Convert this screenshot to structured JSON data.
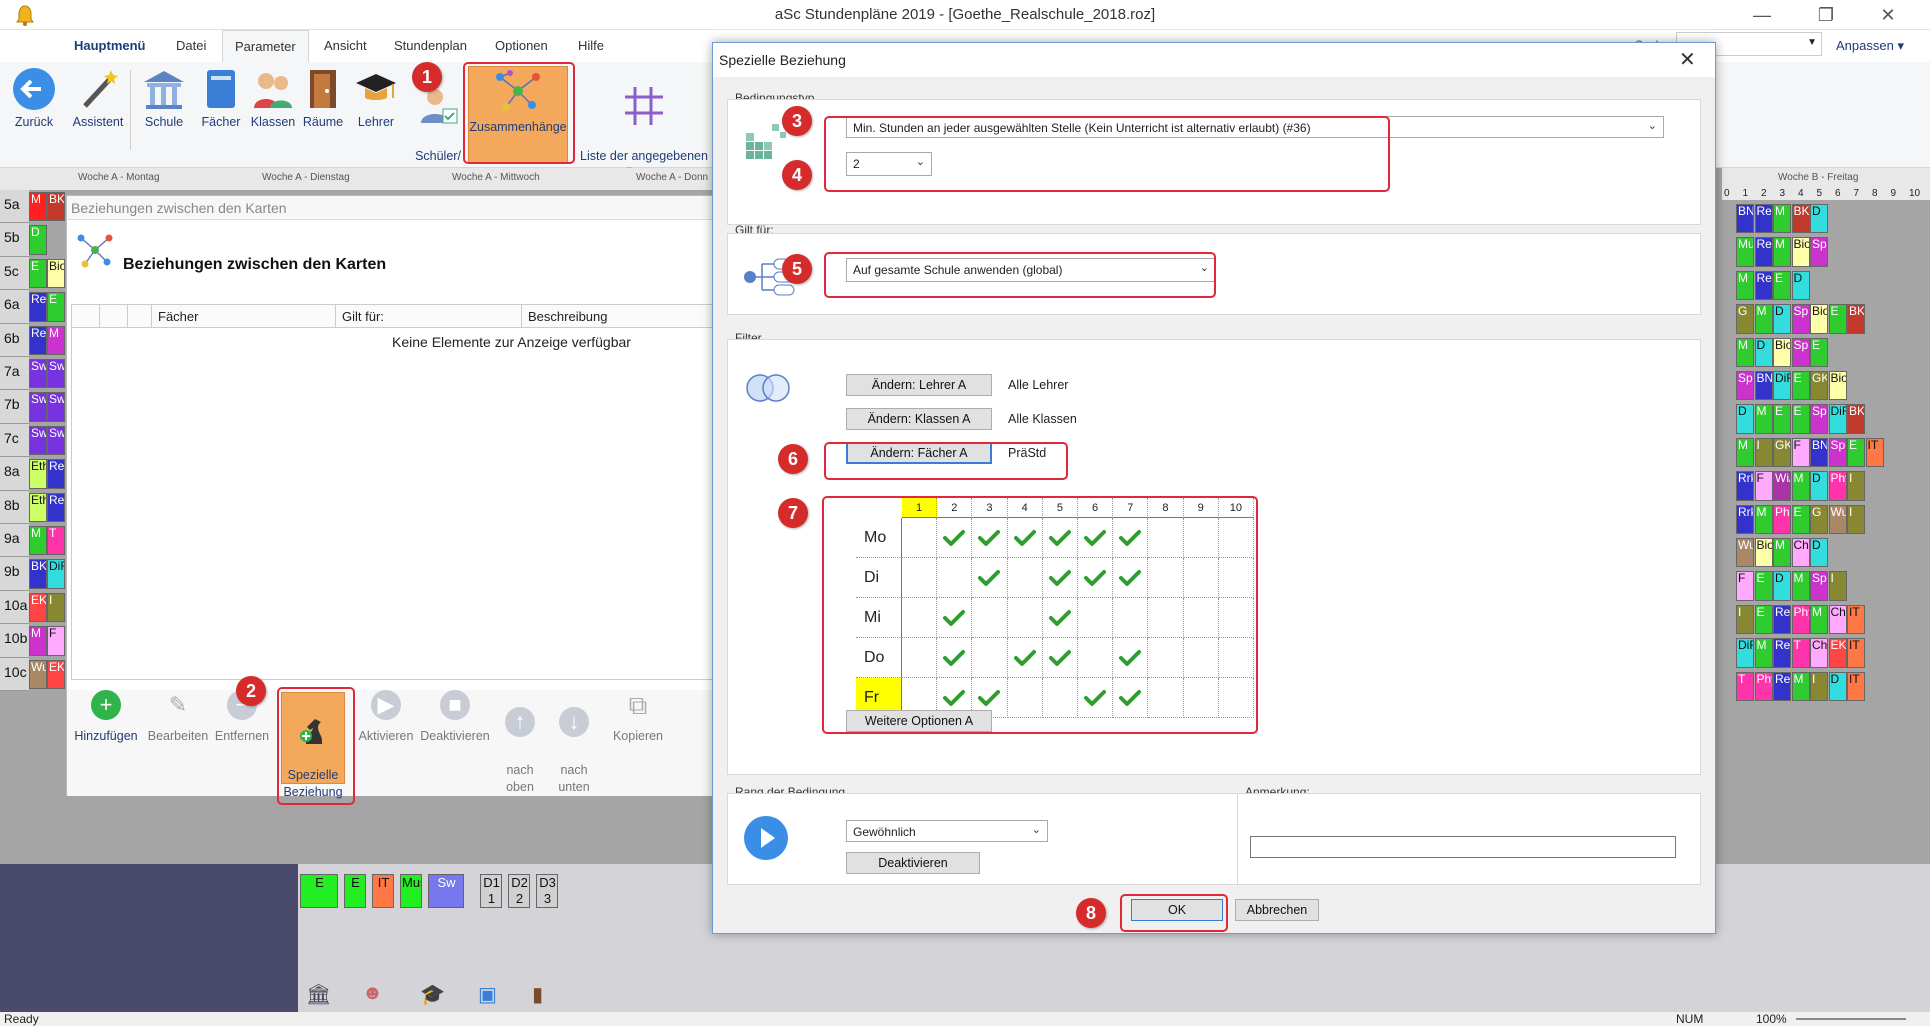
{
  "app": {
    "title": "aSc Stundenpläne 2019  - [Goethe_Realschule_2018.roz]",
    "anpassen": "Anpassen",
    "search_label": "Such"
  },
  "menu_tabs": [
    "Hauptmenü",
    "Datei",
    "Parameter",
    "Ansicht",
    "Stundenplan",
    "Optionen",
    "Hilfe"
  ],
  "ribbon": {
    "buttons": [
      "Zurück",
      "Assistent",
      "Schule",
      "Fächer",
      "Klassen",
      "Räume",
      "Lehrer",
      "Schüler/\nKurse",
      "Zusammenhänge",
      "Liste der angegebenen\nBedingungen"
    ]
  },
  "timetable": {
    "day_headers_left": [
      "Woche A - Montag",
      "Woche A - Dienstag",
      "Woche A - Mittwoch",
      "Woche A - Donn"
    ],
    "day_header_right": "Woche B - Freitag",
    "period_numbers": [
      "0",
      "1",
      "2",
      "3",
      "4",
      "5",
      "6",
      "7",
      "8",
      "9",
      "10"
    ],
    "classes": [
      "5a",
      "5b",
      "5c",
      "6a",
      "6b",
      "7a",
      "7b",
      "7c",
      "8a",
      "8b",
      "9a",
      "9b",
      "10a",
      "10b",
      "10c"
    ],
    "left_cells": [
      [
        {
          "t": "M",
          "c": "#ff2020"
        },
        {
          "t": "BK",
          "c": "#c0392b"
        }
      ],
      [
        {
          "t": "D",
          "c": "#2ecc2e"
        }
      ],
      [
        {
          "t": "E",
          "c": "#2ecc2e"
        },
        {
          "t": "Bio",
          "c": "#ffffaa"
        }
      ],
      [
        {
          "t": "Rev",
          "c": "#3333cc"
        },
        {
          "t": "E",
          "c": "#2ecc2e"
        }
      ],
      [
        {
          "t": "Rev",
          "c": "#3333cc"
        },
        {
          "t": "M",
          "c": "#cc33cc"
        }
      ],
      [
        {
          "t": "Sw",
          "c": "#7733dd"
        },
        {
          "t": "Sw",
          "c": "#7733dd"
        }
      ],
      [
        {
          "t": "Sw",
          "c": "#7733dd"
        },
        {
          "t": "Sw",
          "c": "#7733dd"
        }
      ],
      [
        {
          "t": "Sw",
          "c": "#7733dd"
        },
        {
          "t": "Sw",
          "c": "#7733dd"
        }
      ],
      [
        {
          "t": "Eth",
          "c": "#ccff66"
        },
        {
          "t": "Rev",
          "c": "#3333cc"
        }
      ],
      [
        {
          "t": "Eth",
          "c": "#ccff66"
        },
        {
          "t": "Rev",
          "c": "#3333cc"
        }
      ],
      [
        {
          "t": "M",
          "c": "#2ecc2e"
        },
        {
          "t": "T",
          "c": "#ff33aa"
        }
      ],
      [
        {
          "t": "BK",
          "c": "#3333cc"
        },
        {
          "t": "DiFö",
          "c": "#33dddd"
        }
      ],
      [
        {
          "t": "EK",
          "c": "#ff4444"
        },
        {
          "t": "I",
          "c": "#888833"
        }
      ],
      [
        {
          "t": "M",
          "c": "#cc33cc"
        },
        {
          "t": "F",
          "c": "#ffaaff"
        }
      ],
      [
        {
          "t": "Wu",
          "c": "#aa8866"
        },
        {
          "t": "EK",
          "c": "#ff4444"
        }
      ]
    ],
    "right_rows": [
      [
        "BN",
        "Rev",
        "M",
        "BK",
        "D"
      ],
      [
        "Mus",
        "Rev",
        "M",
        "Bio",
        "Sp"
      ],
      [
        "M",
        "Rev",
        "E",
        "D"
      ],
      [
        "G",
        "M",
        "D",
        "Sp",
        "Bio",
        "E",
        "BK"
      ],
      [
        "M",
        "D",
        "Bio",
        "Sp",
        "E"
      ],
      [
        "Sp",
        "BN",
        "DiFö",
        "E",
        "GK",
        "Bio"
      ],
      [
        "D",
        "M",
        "E",
        "E",
        "Sp",
        "DiFö",
        "BK"
      ],
      [
        "M",
        "I",
        "GK",
        "F",
        "BN",
        "Sp",
        "E",
        "IT"
      ],
      [
        "Rrk",
        "F",
        "Wi/B",
        "M",
        "D",
        "Phy",
        "I"
      ],
      [
        "Rrk",
        "M",
        "Ph",
        "E",
        "G",
        "WuS",
        "I"
      ],
      [
        "WuS",
        "Bio",
        "M",
        "Che",
        "D"
      ],
      [
        "F",
        "E",
        "D",
        "M",
        "Sp",
        "I"
      ],
      [
        "I",
        "E",
        "Rev",
        "Phy",
        "M",
        "Che",
        "IT"
      ],
      [
        "DiFö",
        "M",
        "Rev",
        "T",
        "Che",
        "EK",
        "IT"
      ],
      [
        "T",
        "Phy",
        "Rev",
        "M",
        "I",
        "D",
        "IT"
      ]
    ],
    "right_colors": {
      "BN": "#3333cc",
      "Rev": "#3333cc",
      "M": "#2ecc2e",
      "BK": "#c0392b",
      "D": "#33dddd",
      "Mus": "#2ecc2e",
      "Bio": "#ffffaa",
      "Sp": "#cc33cc",
      "E": "#2ecc2e",
      "G": "#888833",
      "GK": "#888833",
      "DiFö": "#33dddd",
      "F": "#ffaaff",
      "IT": "#ff7744",
      "Rrk": "#3333cc",
      "Wi/B": "#aa33aa",
      "Phy": "#ff33aa",
      "Ph": "#ff33aa",
      "WuS": "#aa8866",
      "Che": "#ffaaff",
      "I": "#888833",
      "T": "#ff33aa",
      "EK": "#ff4444"
    }
  },
  "panel": {
    "header": "Beziehungen zwischen den Karten",
    "title": "Beziehungen zwischen den Karten",
    "columns": [
      "",
      "",
      "",
      "Fächer",
      "Gilt für:",
      "Beschreibung"
    ],
    "empty_text": "Keine Elemente zur Anzeige verfügbar",
    "toolbar": [
      "Hinzufügen",
      "Bearbeiten",
      "Entfernen",
      "Spezielle\nBeziehung",
      "Aktivieren",
      "Deaktivieren",
      "nach\noben",
      "nach\nunten",
      "Kopieren"
    ]
  },
  "bottom_cards": [
    {
      "t": "E",
      "c": "#22ee22"
    },
    {
      "t": "E",
      "c": "#22ee22"
    },
    {
      "t": "IT",
      "c": "#ff7744"
    },
    {
      "t": "Mus",
      "c": "#22ee22"
    },
    {
      "t": "Sw",
      "c": "#7777ee"
    },
    {
      "t": "D1\n1",
      "c": "#d0d0d0"
    },
    {
      "t": "D2\n2",
      "c": "#d0d0d0"
    },
    {
      "t": "D3\n3",
      "c": "#d0d0d0"
    }
  ],
  "dialog": {
    "title": "Spezielle Beziehung",
    "bedingungstyp_label": "Bedingungstyp",
    "condition_type": "Min. Stunden an jeder ausgewählten Stelle (Kein Unterricht ist alternativ erlaubt) (#36)",
    "count_value": "2",
    "gilt_fuer_label": "Gilt für:",
    "gilt_fuer_value": "Auf gesamte Schule anwenden (global)",
    "filter_label": "Filter",
    "filters": [
      {
        "button": "Ändern: Lehrer A",
        "value": "Alle Lehrer"
      },
      {
        "button": "Ändern: Klassen A",
        "value": "Alle Klassen"
      },
      {
        "button": "Ändern: Fächer A",
        "value": "PräStd"
      }
    ],
    "periods": [
      "1",
      "2",
      "3",
      "4",
      "5",
      "6",
      "7",
      "8",
      "9",
      "10"
    ],
    "days": [
      "Mo",
      "Di",
      "Mi",
      "Do",
      "Fr"
    ],
    "checks": [
      [
        false,
        true,
        true,
        true,
        true,
        true,
        true,
        false,
        false,
        false
      ],
      [
        false,
        false,
        true,
        false,
        true,
        true,
        true,
        false,
        false,
        false
      ],
      [
        false,
        true,
        false,
        false,
        true,
        false,
        false,
        false,
        false,
        false
      ],
      [
        false,
        true,
        false,
        true,
        true,
        false,
        true,
        false,
        false,
        false
      ],
      [
        false,
        true,
        true,
        false,
        false,
        true,
        true,
        false,
        false,
        false
      ]
    ],
    "more_options": "Weitere Optionen A",
    "rang_label": "Rang der Bedingung",
    "rang_value": "Gewöhnlich",
    "deactivate": "Deaktivieren",
    "anmerkung_label": "Anmerkung:",
    "anmerkung_value": "",
    "ok": "OK",
    "cancel": "Abbrechen"
  },
  "markers": [
    "1",
    "2",
    "3",
    "4",
    "5",
    "6",
    "7",
    "8"
  ],
  "status": {
    "left": "Ready",
    "num": "NUM",
    "zoom": "100%"
  }
}
